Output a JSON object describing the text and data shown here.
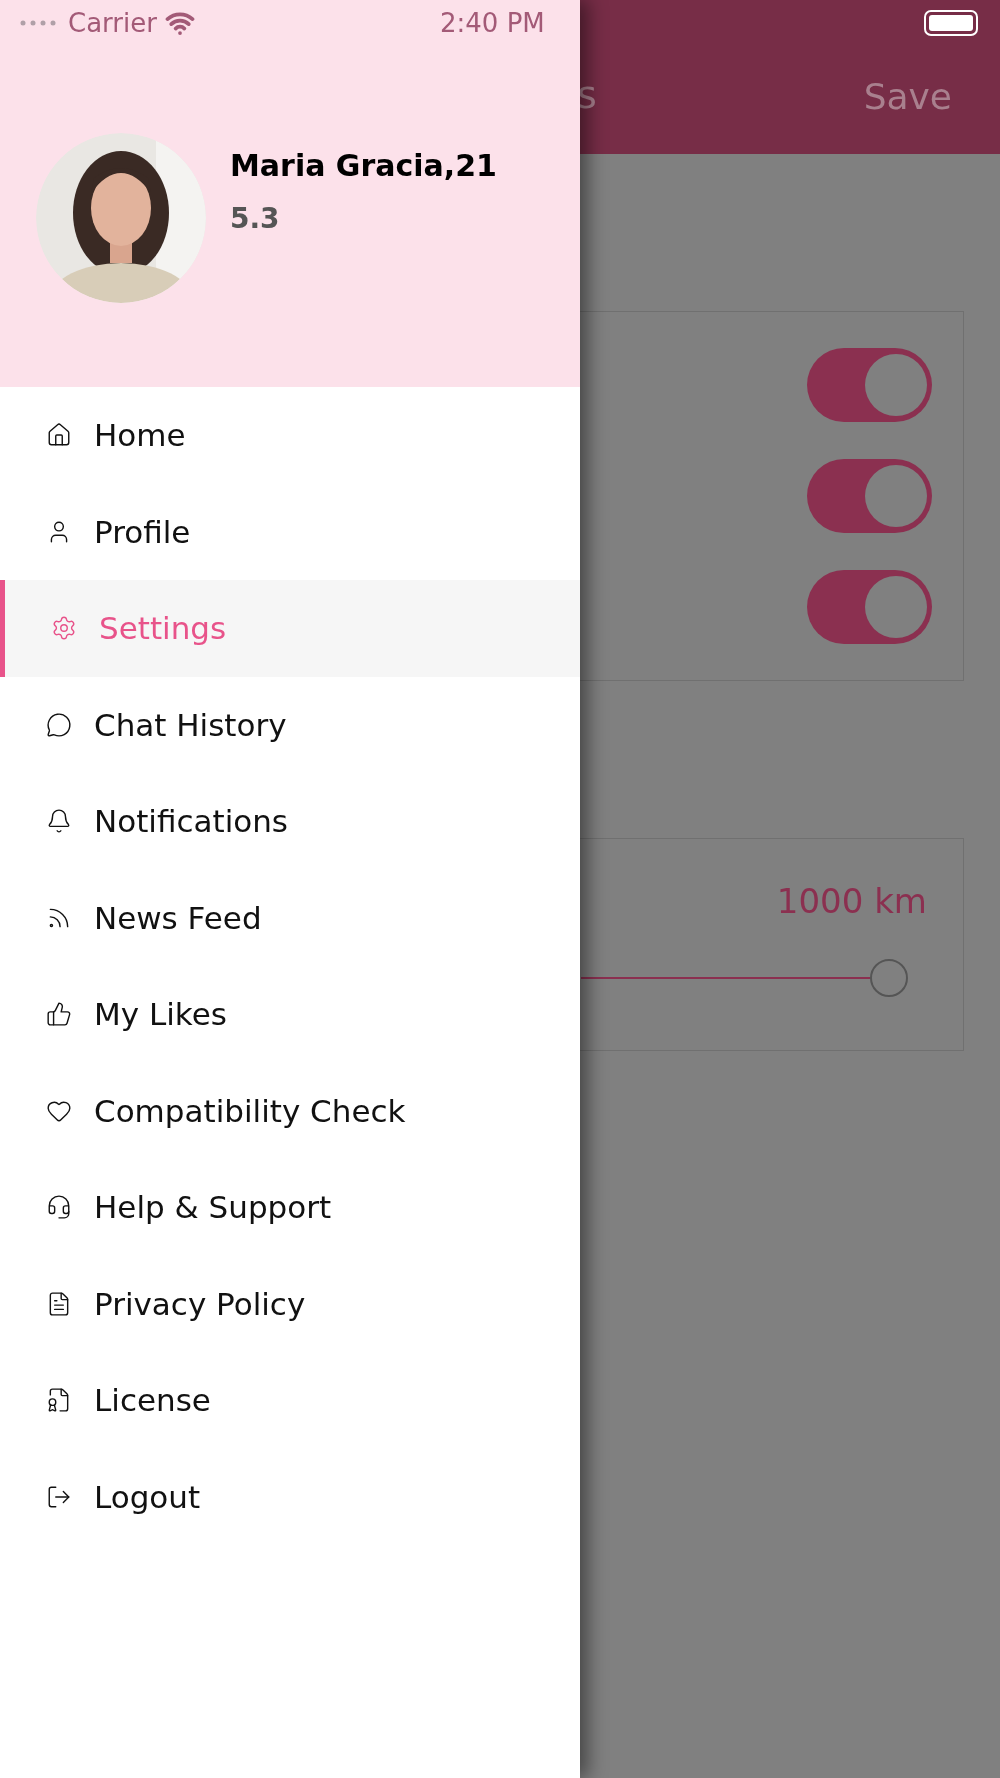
{
  "status_bar": {
    "carrier": "Carrier",
    "time": "2:40 PM"
  },
  "top_bar": {
    "title": "s",
    "save": "Save"
  },
  "settings_card": {
    "toggles": [
      {
        "on": true
      },
      {
        "on": true
      },
      {
        "on": true
      }
    ]
  },
  "distance_card": {
    "reading": "1000 km",
    "level": 1
  },
  "drawer": {
    "profile": {
      "name": "Maria Gracia,21",
      "score": "5.3"
    },
    "items": [
      {
        "label": "Home",
        "selected": false
      },
      {
        "label": "Profile",
        "selected": false
      },
      {
        "label": "Settings",
        "selected": true
      },
      {
        "label": "Chat History",
        "selected": false
      },
      {
        "label": "Notifications",
        "selected": false
      },
      {
        "label": "News Feed",
        "selected": false
      },
      {
        "label": "My Likes",
        "selected": false
      },
      {
        "label": "Compatibility Check",
        "selected": false
      },
      {
        "label": "Help & Support",
        "selected": false
      },
      {
        "label": "Privacy Policy",
        "selected": false
      },
      {
        "label": "License",
        "selected": false
      },
      {
        "label": "Logout",
        "selected": false
      }
    ]
  }
}
